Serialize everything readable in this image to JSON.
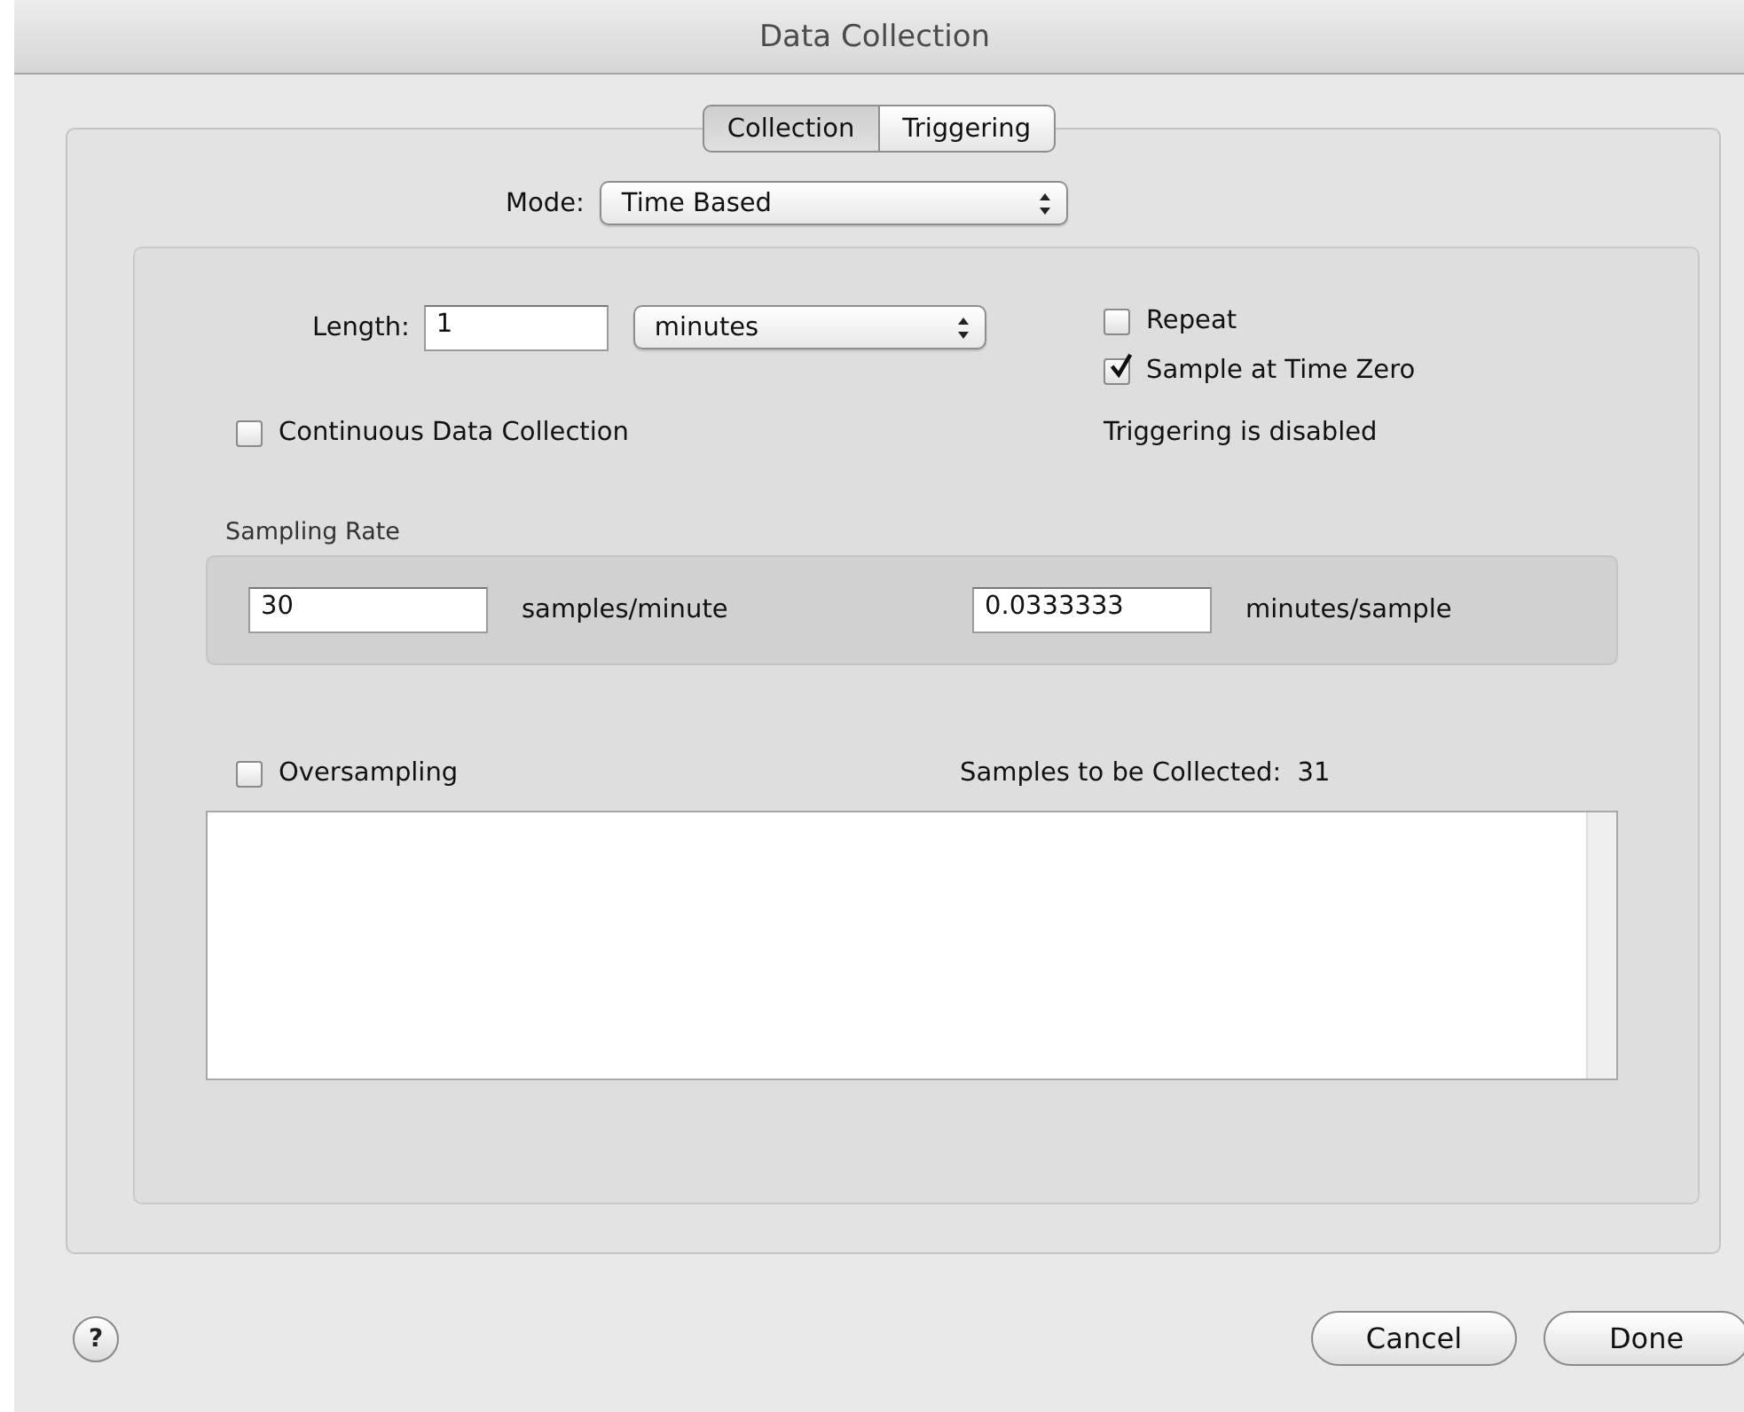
{
  "window": {
    "title": "Data Collection"
  },
  "tabs": [
    {
      "label": "Collection",
      "selected": true
    },
    {
      "label": "Triggering",
      "selected": false
    }
  ],
  "mode": {
    "label": "Mode:",
    "value": "Time Based"
  },
  "length": {
    "label": "Length:",
    "value": "1",
    "unit": "minutes"
  },
  "options": [
    {
      "label": "Repeat",
      "checked": false
    },
    {
      "label": "Sample at Time Zero",
      "checked": true
    }
  ],
  "continuous": {
    "label": "Continuous Data Collection",
    "checked": false
  },
  "trigger_status": "Triggering is disabled",
  "sampling_rate": {
    "title": "Sampling Rate",
    "rate": "30",
    "rate_unit": "samples/minute",
    "interval": "0.0333333",
    "interval_unit": "minutes/sample"
  },
  "oversampling": {
    "label": "Oversampling",
    "checked": false
  },
  "samples_to_collect": {
    "label": "Samples to be Collected:",
    "value": "31"
  },
  "help": "?",
  "buttons": [
    "Cancel",
    "Done"
  ]
}
